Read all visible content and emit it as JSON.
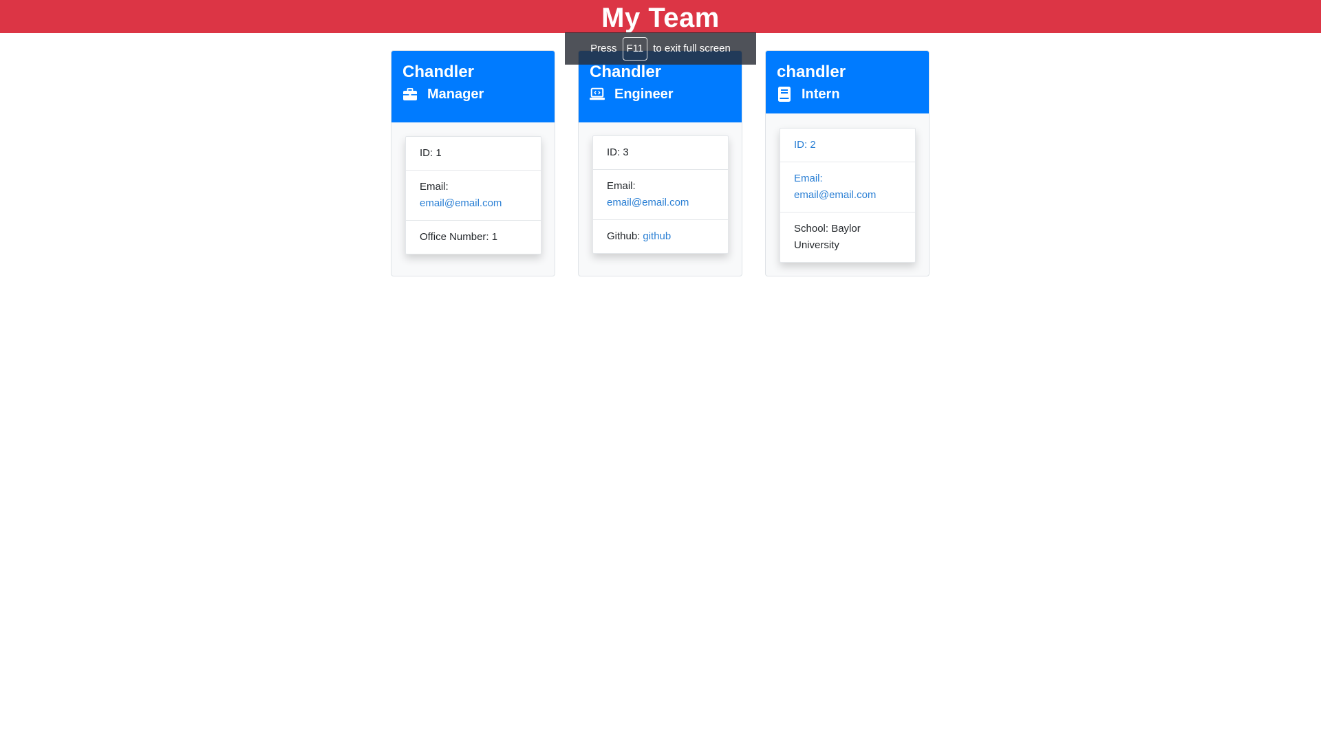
{
  "header": {
    "title": "My Team"
  },
  "fullscreen_hint": {
    "press": "Press",
    "key": "F11",
    "suffix": "to exit full screen"
  },
  "cards": [
    {
      "name": "Chandler",
      "role": "Manager",
      "role_icon": "briefcase-icon",
      "id_text": "ID: 1",
      "email_label": "Email:",
      "email": "email@email.com",
      "extra_text": "Office Number: 1"
    },
    {
      "name": "Chandler",
      "role": "Engineer",
      "role_icon": "laptop-code-icon",
      "id_text": "ID: 3",
      "email_label": "Email:",
      "email": "email@email.com",
      "extra_label": "Github:",
      "extra_link": "github"
    },
    {
      "name": "chandler",
      "role": "Intern",
      "role_icon": "book-icon",
      "id_text": "ID: 2",
      "email_label": "Email:",
      "email": "email@email.com",
      "extra_text": "School: Baylor University"
    }
  ],
  "colors": {
    "topbar": "#dc3545",
    "card_header": "#007bff",
    "link": "#2a7fd4"
  }
}
